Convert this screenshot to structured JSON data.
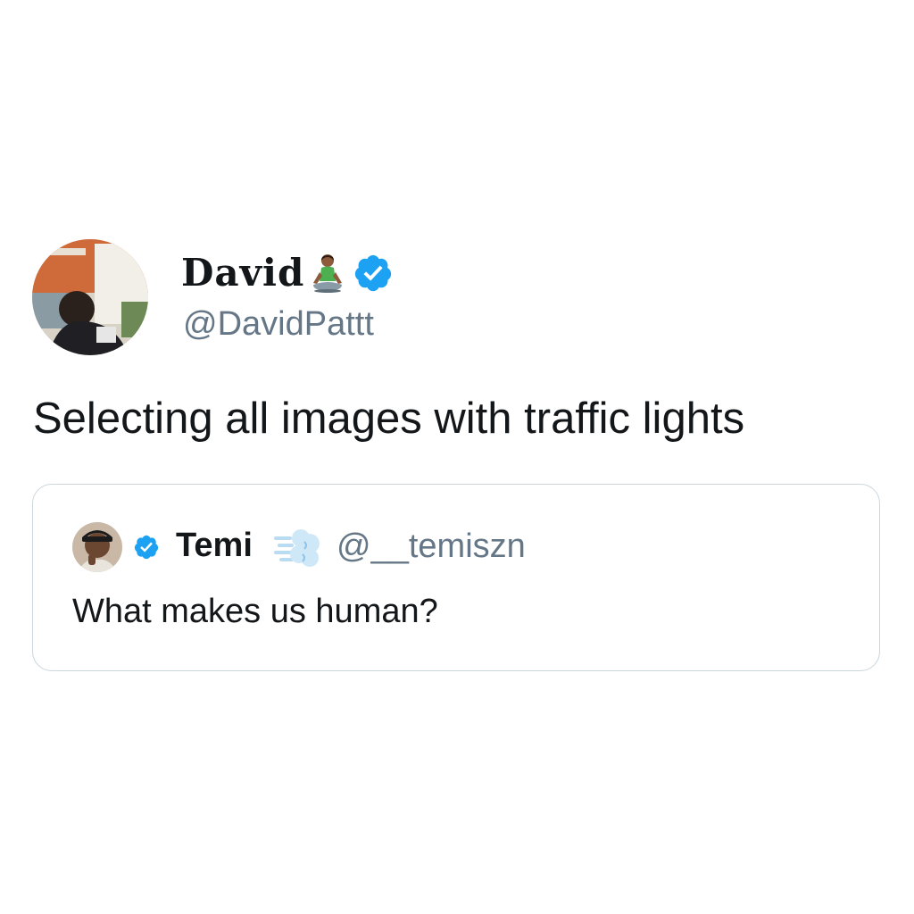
{
  "tweet": {
    "author": {
      "display_name": "David",
      "handle": "@DavidPattt",
      "emoji": "person-in-lotus-position-icon",
      "verified": true
    },
    "text": "Selecting all images with traffic lights"
  },
  "quoted_tweet": {
    "author": {
      "display_name": "Temi",
      "handle": "@__temiszn",
      "emoji": "dashing-away-icon",
      "verified": true
    },
    "text": "What makes us human?"
  },
  "colors": {
    "verified_blue": "#1da1f2",
    "handle_gray": "#657786",
    "text_dark": "#14171a",
    "card_border": "#ccd6dd"
  }
}
